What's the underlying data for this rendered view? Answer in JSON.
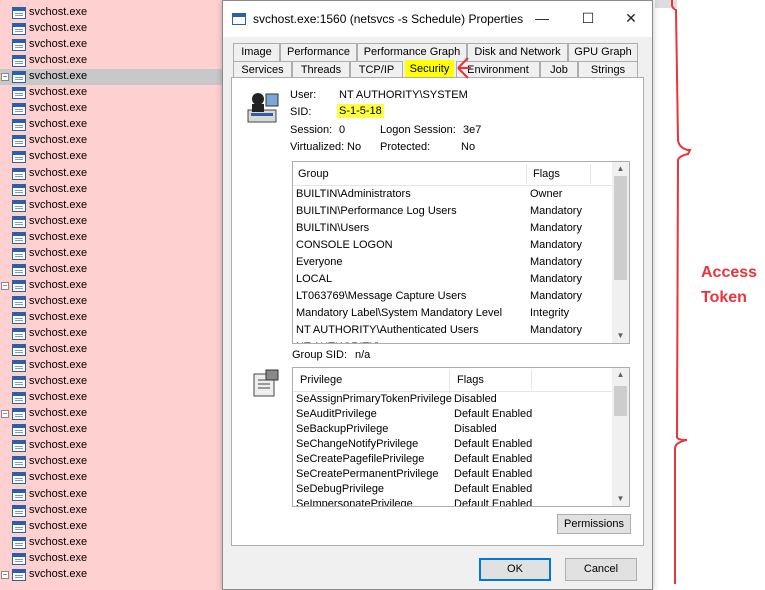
{
  "background_list": {
    "process_name": "svchost.exe",
    "row_count": 36,
    "selected_index": 4,
    "collapse_rows": [
      4,
      17,
      25,
      35
    ],
    "collapse_glyph": "−"
  },
  "dialog": {
    "title": "svchost.exe:1560 (netsvcs -s Schedule) Properties",
    "window_buttons": {
      "minimize": "—",
      "maximize": "☐",
      "close": "✕"
    },
    "tabs_row1": [
      "Image",
      "Performance",
      "Performance Graph",
      "Disk and Network",
      "GPU Graph"
    ],
    "tabs_row2": [
      "Services",
      "Threads",
      "TCP/IP",
      "Security",
      "Environment",
      "Job",
      "Strings"
    ],
    "active_tab": "Security",
    "security": {
      "user_label": "User:",
      "user_value": "NT AUTHORITY\\SYSTEM",
      "sid_label": "SID:",
      "sid_value": "S-1-5-18",
      "session_label": "Session:",
      "session_value": "0",
      "logon_label": "Logon Session:",
      "logon_value": "3e7",
      "virtualized_label": "Virtualized:",
      "virtualized_value": "No",
      "protected_label": "Protected:",
      "protected_value": "No",
      "groups": {
        "col_group": "Group",
        "col_flags": "Flags",
        "sort_glyph": "⌃",
        "rows": [
          [
            "BUILTIN\\Administrators",
            "Owner"
          ],
          [
            "BUILTIN\\Performance Log Users",
            "Mandatory"
          ],
          [
            "BUILTIN\\Users",
            "Mandatory"
          ],
          [
            "CONSOLE LOGON",
            "Mandatory"
          ],
          [
            "Everyone",
            "Mandatory"
          ],
          [
            "LOCAL",
            "Mandatory"
          ],
          [
            "LT063769\\Message Capture Users",
            "Mandatory"
          ],
          [
            "Mandatory Label\\System Mandatory Level",
            "Integrity"
          ],
          [
            "NT AUTHORITY\\Authenticated Users",
            "Mandatory"
          ],
          [
            "NT AUTHORITY\\...",
            "..."
          ]
        ]
      },
      "group_sid_label": "Group SID:",
      "group_sid_value": "n/a",
      "privileges": {
        "col_privilege": "Privilege",
        "col_flags": "Flags",
        "rows": [
          [
            "SeAssignPrimaryTokenPrivilege",
            "Disabled"
          ],
          [
            "SeAuditPrivilege",
            "Default Enabled"
          ],
          [
            "SeBackupPrivilege",
            "Disabled"
          ],
          [
            "SeChangeNotifyPrivilege",
            "Default Enabled"
          ],
          [
            "SeCreatePagefilePrivilege",
            "Default Enabled"
          ],
          [
            "SeCreatePermanentPrivilege",
            "Default Enabled"
          ],
          [
            "SeDebugPrivilege",
            "Default Enabled"
          ],
          [
            "SeImpersonatePrivilege",
            "Default Enabled"
          ]
        ]
      },
      "permissions_button": "Permissions"
    },
    "ok_button": "OK",
    "cancel_button": "Cancel"
  },
  "annotation": {
    "text": "Access Token",
    "color": "#e8343a",
    "highlight_color": "#ffff00"
  }
}
